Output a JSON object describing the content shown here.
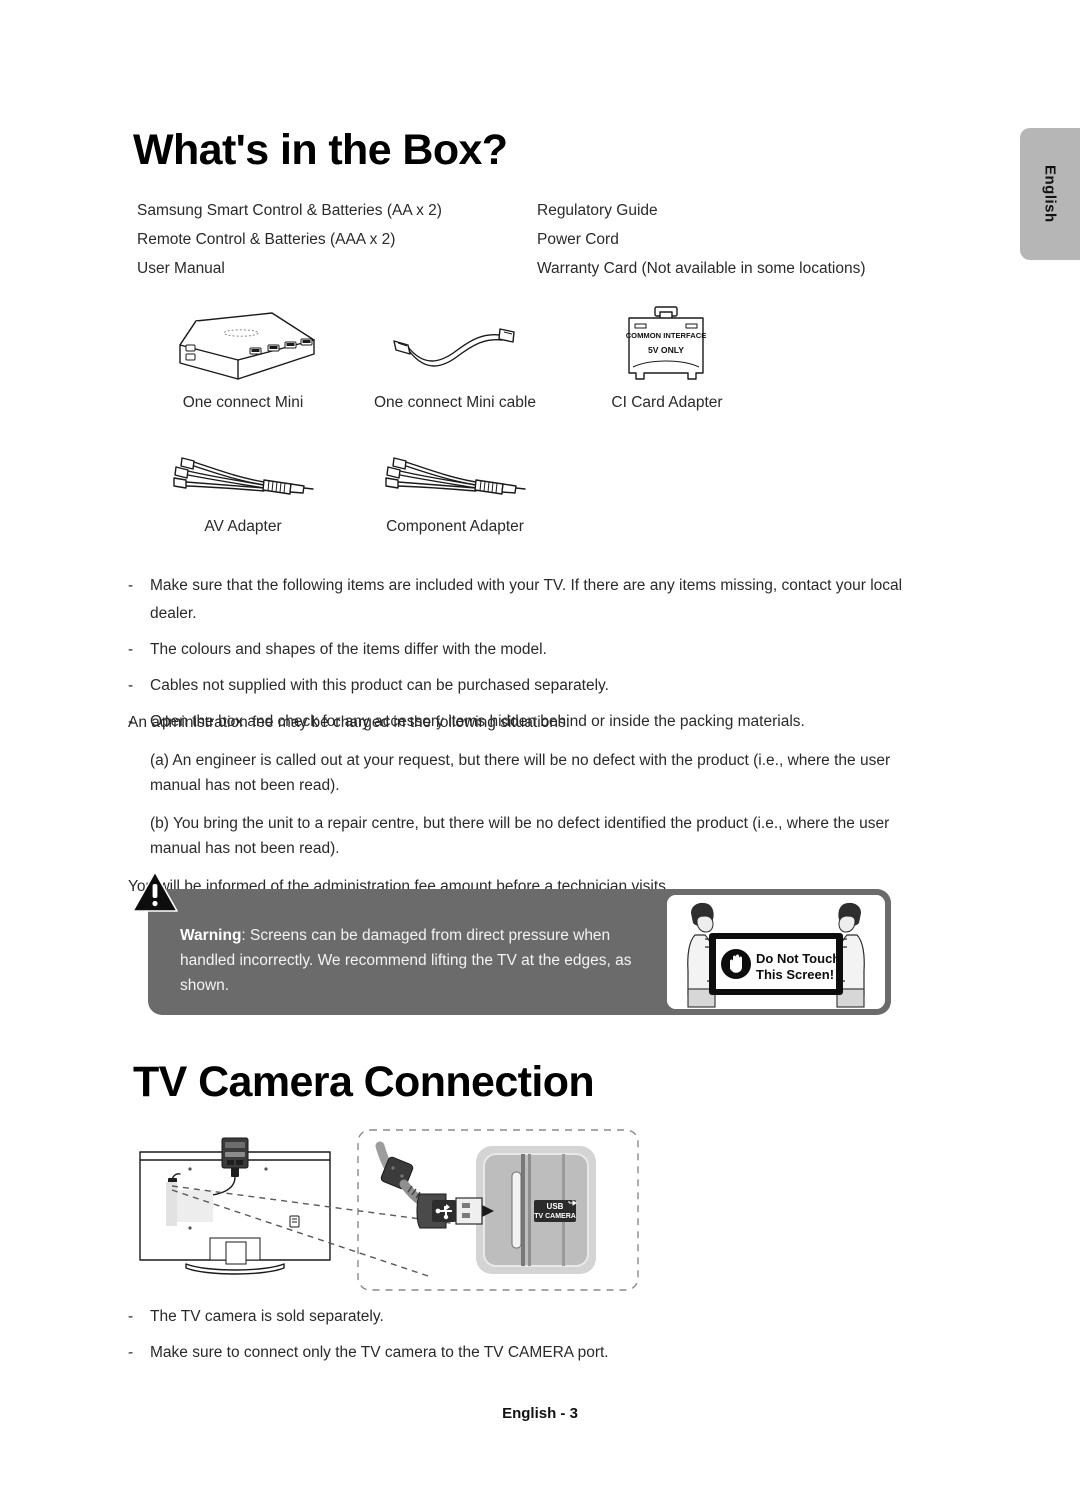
{
  "language_tab": {
    "label": "English"
  },
  "sections": {
    "box": {
      "title": "What's in the Box?",
      "contents_left": [
        "Samsung Smart Control & Batteries (AA x 2)",
        "Remote Control & Batteries (AAA x 2)",
        "User Manual"
      ],
      "contents_right": [
        "Regulatory Guide",
        "Power Cord",
        "Warranty Card (Not available in some locations)"
      ],
      "accessories": [
        {
          "label": "One connect Mini",
          "icon": "one-connect-mini-box-icon"
        },
        {
          "label": "One connect Mini cable",
          "icon": "one-connect-mini-cable-icon"
        },
        {
          "label": "CI Card Adapter",
          "icon": "ci-card-adapter-icon"
        },
        {
          "label": "AV Adapter",
          "icon": "av-adapter-cable-icon"
        },
        {
          "label": "Component Adapter",
          "icon": "component-adapter-cable-icon"
        }
      ],
      "ci_card_labels": {
        "line1": "COMMON INTERFACE",
        "line2": "5V ONLY"
      },
      "notes": [
        "Make sure that the following items are included with your TV. If there are any items missing, contact your local dealer.",
        "The colours and shapes of the items differ with the model.",
        "Cables not supplied with this product can be purchased separately.",
        "Open the box and check for any accessory items hidden behind or inside the packing materials."
      ],
      "bullet_marker": "-",
      "admin_fee": {
        "intro": "An administration fee may be charged in the following situations:",
        "item_a": "(a) An engineer is called out at your request, but there will be no defect with the product (i.e., where the user manual has not been read).",
        "item_b": "(b) You bring the unit to a repair centre, but there will be no defect identified the product (i.e., where the user manual has not been read).",
        "outro": "You will be informed of the administration fee amount before a technician visits."
      },
      "warning": {
        "label": "Warning",
        "separator": ":",
        "text": " Screens can be damaged from direct pressure when handled incorrectly. We recommend lifting the TV at the edges, as shown.",
        "illustration_line1": "Do Not Touch",
        "illustration_line2": "This Screen!",
        "background_color": "#6b6b6b"
      }
    },
    "camera": {
      "title": "TV Camera Connection",
      "port_label_line1": "USB",
      "port_label_line2": "TV CAMERA",
      "notes": [
        "The TV camera is sold separately.",
        "Make sure to connect only the TV camera to the TV CAMERA port."
      ]
    }
  },
  "footer": {
    "text": "English - 3"
  }
}
